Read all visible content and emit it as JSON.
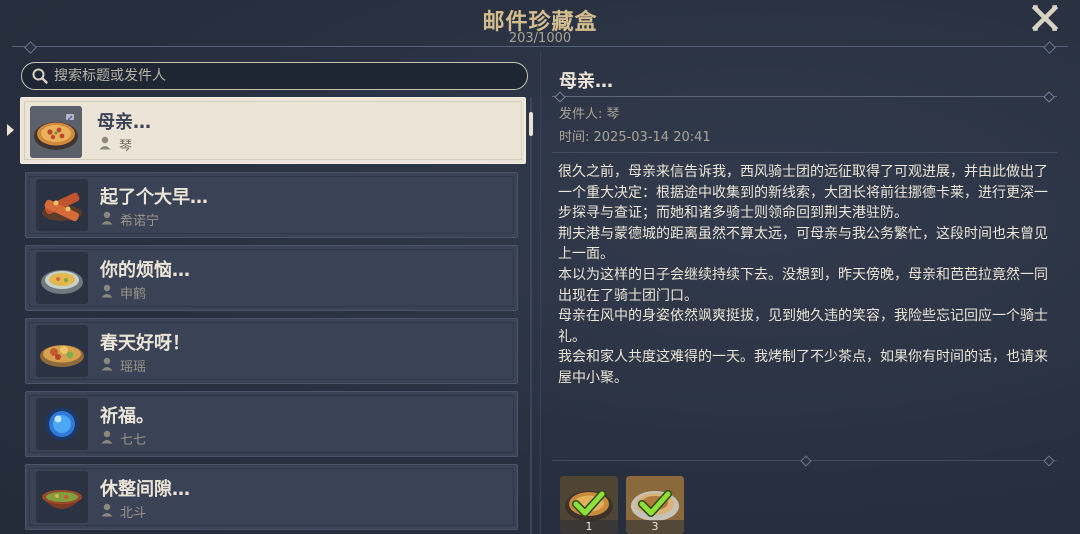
{
  "header": {
    "title": "邮件珍藏盒",
    "count": "203/1000"
  },
  "search": {
    "placeholder": "搜索标题或发件人"
  },
  "mail_list": [
    {
      "title": "母亲…",
      "sender": "琴",
      "icon": "pizza-dish-icon",
      "selected": true
    },
    {
      "title": "起了个大早…",
      "sender": "希诺宁",
      "icon": "skewer-dish-icon",
      "selected": false
    },
    {
      "title": "你的烦恼…",
      "sender": "申鹤",
      "icon": "soup-dish-icon",
      "selected": false
    },
    {
      "title": "春天好呀！",
      "sender": "瑶瑶",
      "icon": "platter-dish-icon",
      "selected": false
    },
    {
      "title": "祈福。",
      "sender": "七七",
      "icon": "blue-orb-icon",
      "selected": false
    },
    {
      "title": "休整间隙…",
      "sender": "北斗",
      "icon": "stew-bowl-icon",
      "selected": false
    }
  ],
  "detail": {
    "title": "母亲…",
    "sender_line": "发件人: 琴",
    "time_line": "时间: 2025-03-14 20:41",
    "paragraphs": [
      "很久之前，母亲来信告诉我，西风骑士团的远征取得了可观进展，并由此做出了一个重大决定：根据途中收集到的新线索，大团长将前往挪德卡莱，进行更深一步探寻与查证；而她和诸多骑士则领命回到荆夫港驻防。",
      "荆夫港与蒙德城的距离虽然不算太远，可母亲与我公务繁忙，这段时间也未曾见上一面。",
      "本以为这样的日子会继续持续下去。没想到，昨天傍晚，母亲和芭芭拉竟然一同出现在了骑士团门口。",
      "母亲在风中的身姿依然飒爽挺拔，见到她久违的笑容，我险些忘记回应一个骑士礼。",
      "我会和家人共度这难得的一天。我烤制了不少茶点，如果你有时间的话，也请来屋中小聚。"
    ],
    "attachments": [
      {
        "icon": "pizza-dish-icon",
        "count": "1",
        "claimed": true
      },
      {
        "icon": "cake-dish-icon",
        "count": "3",
        "claimed": true
      }
    ]
  },
  "colors": {
    "gold": "#d3bc8e",
    "selected_bg": "#ece5d7",
    "panel_bg": "#2b3343",
    "check_green": "#7ed321"
  }
}
